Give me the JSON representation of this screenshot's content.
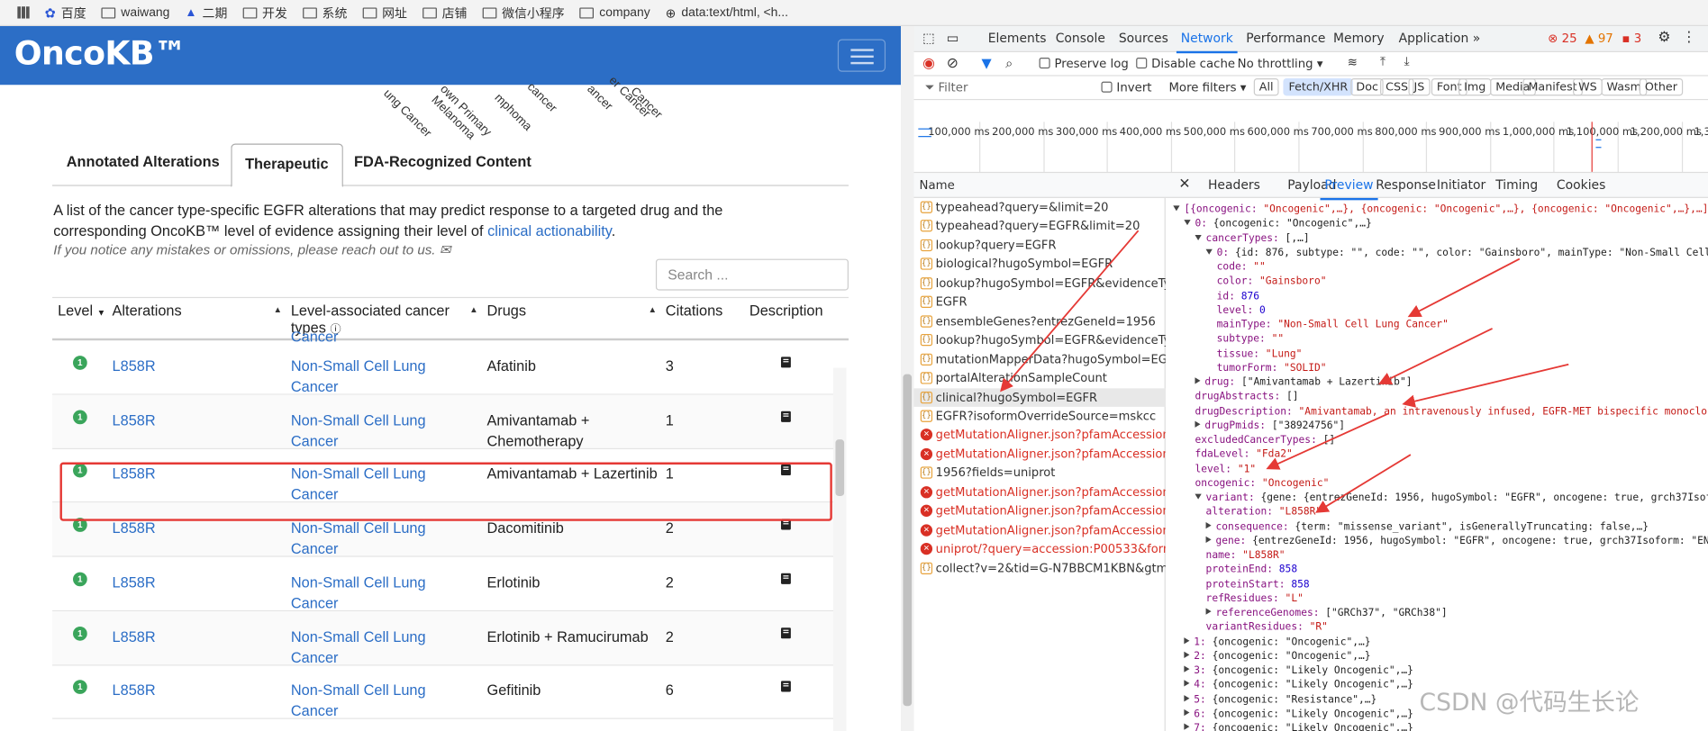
{
  "bookmarks": [
    "百度",
    "waiwang",
    "二期",
    "开发",
    "系统",
    "网址",
    "店铺",
    "微信小程序",
    "company",
    "data:text/html, <h..."
  ],
  "app": {
    "logo": "OncoKB™"
  },
  "cancer_types_partial": [
    "ung Cancer",
    "own Primary",
    "Melanoma",
    "mphoma",
    "cancer",
    "ancer",
    "er Cancer",
    "Cancer"
  ],
  "tabs": [
    "Annotated Alterations",
    "Therapeutic",
    "FDA-Recognized Content"
  ],
  "description": {
    "text": "A list of the cancer type-specific EGFR alterations that may predict response to a targeted drug and the corresponding OncoKB™ level of evidence assigning their level of",
    "link": "clinical actionability",
    "end": ".",
    "note": "If you notice any mistakes or omissions, please reach out to us."
  },
  "search": {
    "placeholder": "Search ..."
  },
  "table": {
    "headers": [
      "Level",
      "Alterations",
      "Level-associated cancer types",
      "Drugs",
      "Citations",
      "Description"
    ],
    "cut_text": "Cancer",
    "rows": [
      {
        "level": "1",
        "alteration": "L858R",
        "cancer": "Non-Small Cell Lung Cancer",
        "drug": "Afatinib",
        "citations": "3"
      },
      {
        "level": "1",
        "alteration": "L858R",
        "cancer": "Non-Small Cell Lung Cancer",
        "drug": "Amivantamab + Chemotherapy",
        "citations": "1"
      },
      {
        "level": "1",
        "alteration": "L858R",
        "cancer": "Non-Small Cell Lung Cancer",
        "drug": "Amivantamab + Lazertinib",
        "citations": "1"
      },
      {
        "level": "1",
        "alteration": "L858R",
        "cancer": "Non-Small Cell Lung Cancer",
        "drug": "Dacomitinib",
        "citations": "2"
      },
      {
        "level": "1",
        "alteration": "L858R",
        "cancer": "Non-Small Cell Lung Cancer",
        "drug": "Erlotinib",
        "citations": "2"
      },
      {
        "level": "1",
        "alteration": "L858R",
        "cancer": "Non-Small Cell Lung Cancer",
        "drug": "Erlotinib + Ramucirumab",
        "citations": "2"
      },
      {
        "level": "1",
        "alteration": "L858R",
        "cancer": "Non-Small Cell Lung Cancer",
        "drug": "Gefitinib",
        "citations": "6"
      }
    ]
  },
  "devtools": {
    "tabs": [
      "Elements",
      "Console",
      "Sources",
      "Network",
      "Performance",
      "Memory",
      "Application"
    ],
    "active_tab": "Network",
    "errors": "25",
    "warnings": "97",
    "issues": "3",
    "toolbar": {
      "preserve": "Preserve log",
      "disable_cache": "Disable cache",
      "throttle": "No throttling"
    },
    "filter": {
      "placeholder": "Filter",
      "invert": "Invert",
      "more": "More filters"
    },
    "types": [
      "All",
      "Fetch/XHR",
      "Doc",
      "CSS",
      "JS",
      "Font",
      "Img",
      "Media",
      "Manifest",
      "WS",
      "Wasm",
      "Other"
    ],
    "timeline": [
      "100,000 ms",
      "200,000 ms",
      "300,000 ms",
      "400,000 ms",
      "500,000 ms",
      "600,000 ms",
      "700,000 ms",
      "800,000 ms",
      "900,000 ms",
      "1,000,000 ms",
      "1,100,000 ms",
      "1,200,000 ms",
      "1,30"
    ],
    "name_header": "Name",
    "detail_tabs": [
      "Headers",
      "Payload",
      "Preview",
      "Response",
      "Initiator",
      "Timing",
      "Cookies"
    ],
    "requests": [
      {
        "name": "typeahead?query=&limit=20",
        "err": false
      },
      {
        "name": "typeahead?query=EGFR&limit=20",
        "err": false
      },
      {
        "name": "lookup?query=EGFR",
        "err": false
      },
      {
        "name": "biological?hugoSymbol=EGFR",
        "err": false
      },
      {
        "name": "lookup?hugoSymbol=EGFR&evidenceTyp...",
        "err": false
      },
      {
        "name": "EGFR",
        "err": false
      },
      {
        "name": "ensembleGenes?entrezGeneId=1956",
        "err": false
      },
      {
        "name": "lookup?hugoSymbol=EGFR&evidenceTyp...",
        "err": false
      },
      {
        "name": "mutationMapperData?hugoSymbol=EGFR",
        "err": false
      },
      {
        "name": "portalAlterationSampleCount",
        "err": false
      },
      {
        "name": "clinical?hugoSymbol=EGFR",
        "err": false,
        "sel": true
      },
      {
        "name": "EGFR?isoformOverrideSource=mskcc",
        "err": false
      },
      {
        "name": "getMutationAligner.json?pfamAccession=...",
        "err": true
      },
      {
        "name": "getMutationAligner.json?pfamAccession=...",
        "err": true
      },
      {
        "name": "1956?fields=uniprot",
        "err": false
      },
      {
        "name": "getMutationAligner.json?pfamAccession=...",
        "err": true
      },
      {
        "name": "getMutationAligner.json?pfamAccession=...",
        "err": true
      },
      {
        "name": "getMutationAligner.json?pfamAccession=...",
        "err": true
      },
      {
        "name": "uniprot/?query=accession:P00533&forma...",
        "err": true
      },
      {
        "name": "collect?v=2&tid=G-N7BBCM1KBN&gtm=...",
        "err": false
      }
    ],
    "preview_lines": [
      "[{oncogenic: \"Oncogenic\",…}, {oncogenic: \"Oncogenic\",…}, {oncogenic: \"Oncogenic\",…},…]",
      "0: {oncogenic: \"Oncogenic\",…}",
      "cancerTypes: [,…]",
      "0: {id: 876, subtype: \"\", code: \"\", color: \"Gainsboro\", mainType: \"Non-Small Cell Lung Cancer\"",
      "code: \"\"",
      "color: \"Gainsboro\"",
      "id: 876",
      "level: 0",
      "mainType: \"Non-Small Cell Lung Cancer\"",
      "subtype: \"\"",
      "tissue: \"Lung\"",
      "tumorForm: \"SOLID\"",
      "drug: [\"Amivantamab + Lazertinib\"]",
      "drugAbstracts: []",
      "drugDescription: \"Amivantamab, an intravenously infused, EGFR-MET bispecific monoclonal antibody",
      "drugPmids: [\"38924756\"]",
      "excludedCancerTypes: []",
      "fdaLevel: \"Fda2\"",
      "level: \"1\"",
      "oncogenic: \"Oncogenic\"",
      "variant: {gene: {entrezGeneId: 1956, hugoSymbol: \"EGFR\", oncogene: true, grch37Isoform: \"ENST",
      "alteration: \"L858R\"",
      "consequence: {term: \"missense_variant\", isGenerallyTruncating: false,…}",
      "gene: {entrezGeneId: 1956, hugoSymbol: \"EGFR\", oncogene: true, grch37Isoform: \"ENST00000275",
      "name: \"L858R\"",
      "proteinEnd: 858",
      "proteinStart: 858",
      "refResidues: \"L\"",
      "referenceGenomes: [\"GRCh37\", \"GRCh38\"]",
      "variantResidues: \"R\"",
      "1: {oncogenic: \"Oncogenic\",…}",
      "2: {oncogenic: \"Oncogenic\",…}",
      "3: {oncogenic: \"Likely Oncogenic\",…}",
      "4: {oncogenic: \"Likely Oncogenic\",…}",
      "5: {oncogenic: \"Resistance\",…}",
      "6: {oncogenic: \"Likely Oncogenic\",…}",
      "7: {oncogenic: \"Likely Oncogenic\",…}"
    ]
  },
  "watermark": "CSDN @代码生长论",
  "colors": {
    "brand": "#2c6ec6",
    "level1": "#3aa55b",
    "highlight": "#e53935",
    "devtools_active": "#1a73e8"
  }
}
